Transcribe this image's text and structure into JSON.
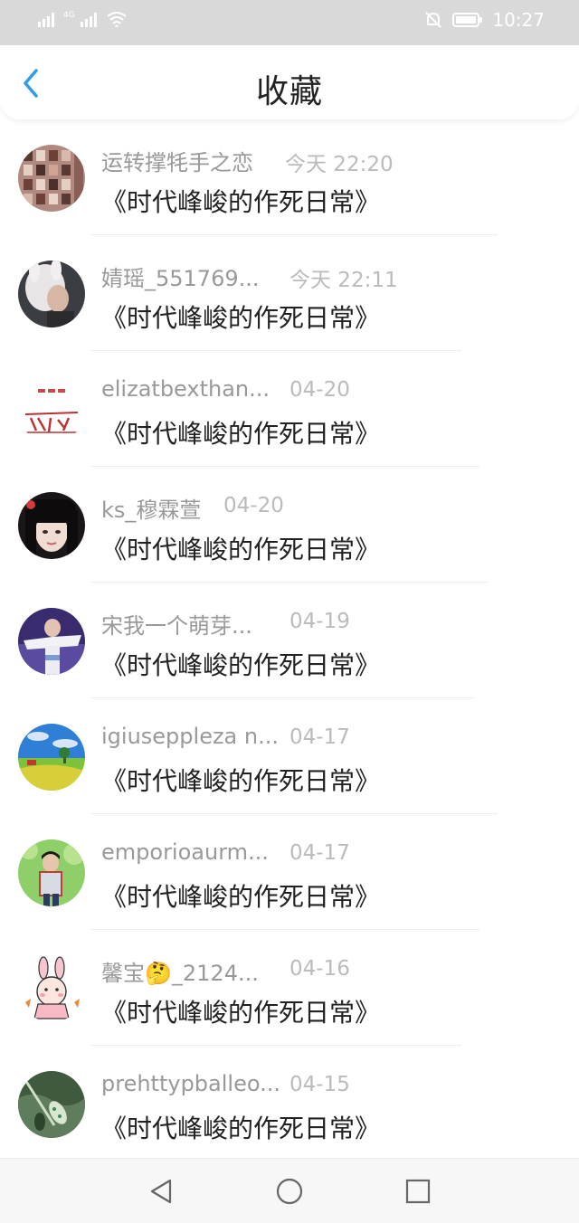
{
  "status_bar": {
    "signal_1": "signal-icon",
    "network": "4G",
    "signal_2": "signal-icon",
    "wifi": "wifi-icon",
    "mute": "mute-icon",
    "battery": "battery-icon",
    "time": "10:27"
  },
  "header": {
    "title": "收藏",
    "back_icon": "chevron-left-icon",
    "accent_color": "#2f9ee8"
  },
  "favorites": [
    {
      "name": "运转撑牦手之恋",
      "time": "今天 22:20",
      "book": "《时代峰峻的作死日常》",
      "avatar": "photo-grid"
    },
    {
      "name": "婧瑶_551769...",
      "time": "今天 22:11",
      "book": "《时代峰峻的作死日常》",
      "avatar": "girl-bunny-hat"
    },
    {
      "name": "elizatbexthan...",
      "time": "04-20",
      "book": "《时代峰峻的作死日常》",
      "avatar": "text-calligraphy"
    },
    {
      "name": "ks_穆霖萱",
      "time": "04-20",
      "book": "《时代峰峻的作死日常》",
      "avatar": "girl-portrait"
    },
    {
      "name": "宋我一个萌芽...",
      "time": "04-19",
      "book": "《时代峰峻的作死日常》",
      "avatar": "performer"
    },
    {
      "name": "igiuseppleza n...",
      "time": "04-17",
      "book": "《时代峰峻的作死日常》",
      "avatar": "landscape"
    },
    {
      "name": "emporioaurm...",
      "time": "04-17",
      "book": "《时代峰峻的作死日常》",
      "avatar": "boy-outdoors"
    },
    {
      "name": "馨宝🤔_2124...",
      "time": "04-16",
      "book": "《时代峰峻的作死日常》",
      "avatar": "cartoon-bunny"
    },
    {
      "name": "prehttypballeo...",
      "time": "04-15",
      "book": "《时代峰峻的作死日常》",
      "avatar": "leaves"
    }
  ],
  "nav_bar": {
    "back": "triangle-back-icon",
    "home": "circle-home-icon",
    "recents": "square-recents-icon"
  }
}
